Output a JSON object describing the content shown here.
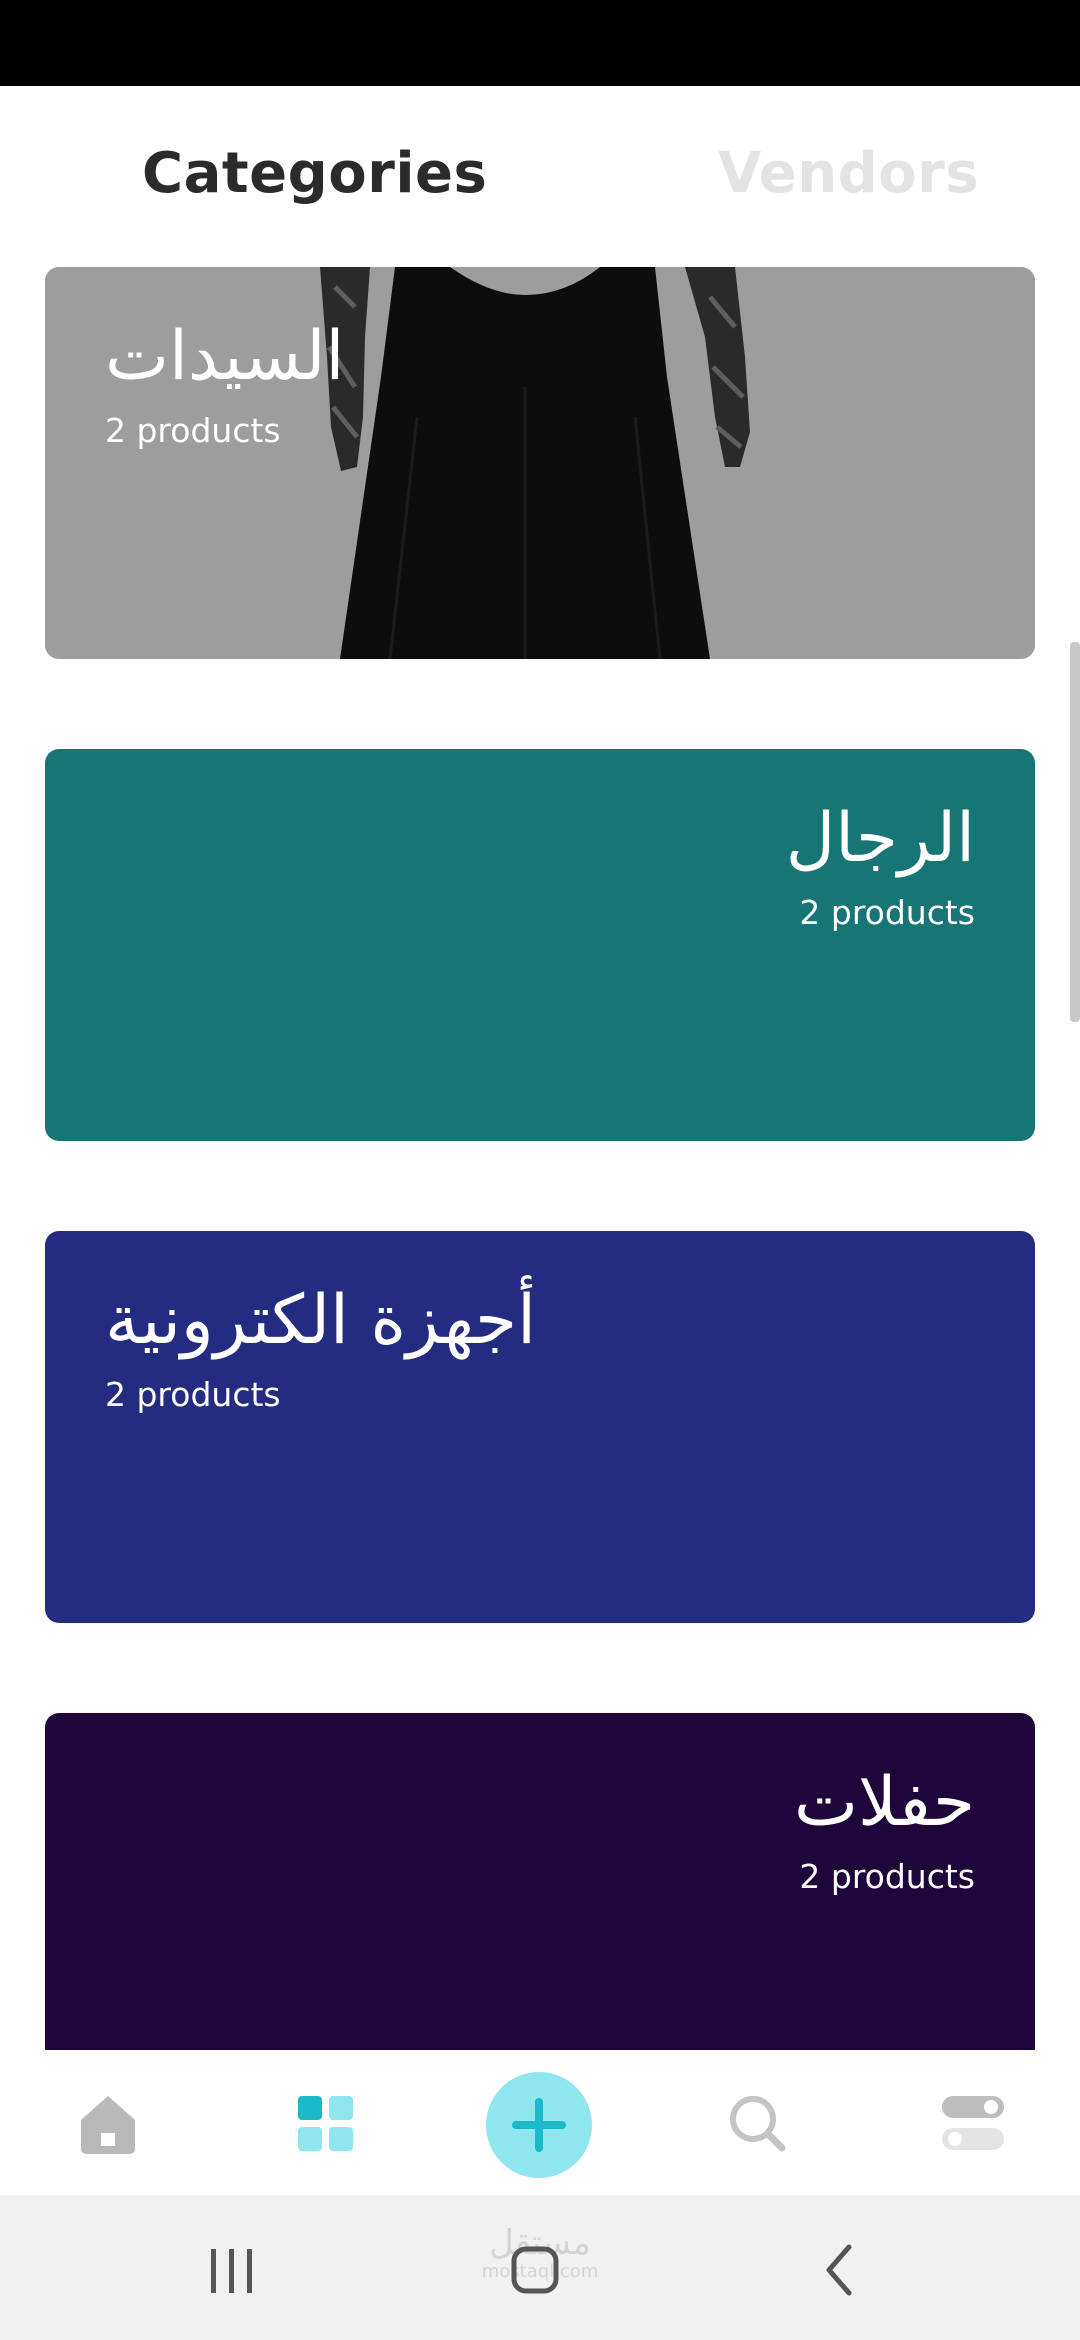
{
  "tabs": {
    "categories": "Categories",
    "vendors": "Vendors"
  },
  "categories": [
    {
      "title": "السيدات",
      "count": "2 products",
      "color": "#9b9b9b",
      "has_image": true
    },
    {
      "title": "الرجال",
      "count": "2 products",
      "color": "#177575"
    },
    {
      "title": "أجهزة الكترونية",
      "count": "2 products",
      "color": "#232c80"
    },
    {
      "title": "حفلات",
      "count": "2 products",
      "color": "#1e063a"
    }
  ],
  "bottom_nav": {
    "items": [
      "home-icon",
      "categories-grid-icon",
      "add-icon",
      "search-icon",
      "settings-toggle-icon"
    ],
    "active": "categories-grid-icon",
    "accent": "#1bb9c9"
  },
  "watermark": {
    "main": "مستقل",
    "sub": "mostaql.com"
  }
}
